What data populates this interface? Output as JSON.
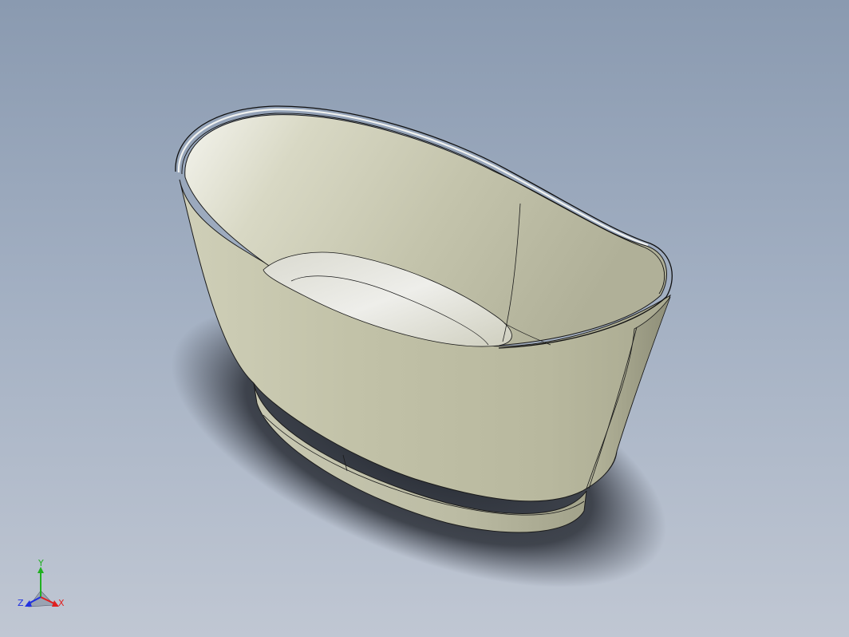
{
  "model": {
    "name": "bathtub",
    "shading": "shaded-with-edges",
    "colors": {
      "background_top": "#8a9ab0",
      "background_bottom": "#c0c7d3",
      "body": "#c4c4ac",
      "interior": "#dcdcd0",
      "edge": "#1a1a1a",
      "shadow": "#2a2e36"
    }
  },
  "triad": {
    "x_label": "X",
    "y_label": "Y",
    "z_label": "Z",
    "x_color": "#e02020",
    "y_color": "#20b020",
    "z_color": "#2030e0"
  }
}
